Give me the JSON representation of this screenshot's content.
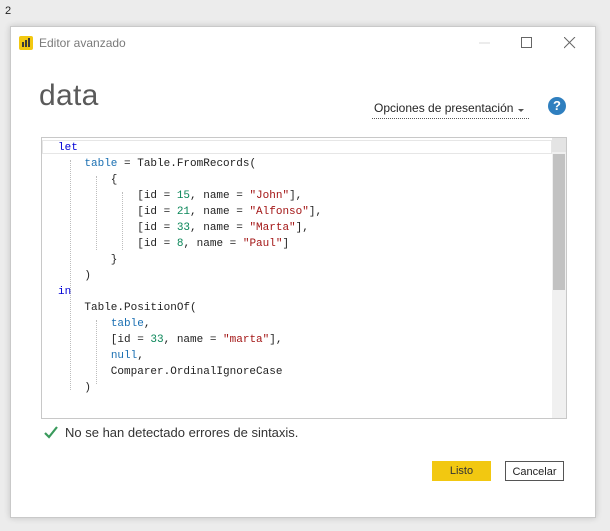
{
  "page_label": "2",
  "window": {
    "title": "Editor avanzado",
    "icon": "power-bi-icon"
  },
  "query": {
    "name": "data"
  },
  "toolbar": {
    "display_options_label": "Opciones de presentación",
    "help_symbol": "?"
  },
  "code_lines": [
    [
      {
        "t": "let",
        "c": "kw"
      }
    ],
    [
      {
        "t": "    "
      },
      {
        "t": "table",
        "c": "var"
      },
      {
        "t": " = Table.FromRecords("
      }
    ],
    [
      {
        "t": "        {"
      }
    ],
    [
      {
        "t": "            [id = "
      },
      {
        "t": "15",
        "c": "num"
      },
      {
        "t": ", name = "
      },
      {
        "t": "\"John\"",
        "c": "str"
      },
      {
        "t": "],"
      }
    ],
    [
      {
        "t": "            [id = "
      },
      {
        "t": "21",
        "c": "num"
      },
      {
        "t": ", name = "
      },
      {
        "t": "\"Alfonso\"",
        "c": "str"
      },
      {
        "t": "],"
      }
    ],
    [
      {
        "t": "            [id = "
      },
      {
        "t": "33",
        "c": "num"
      },
      {
        "t": ", name = "
      },
      {
        "t": "\"Marta\"",
        "c": "str"
      },
      {
        "t": "],"
      }
    ],
    [
      {
        "t": "            [id = "
      },
      {
        "t": "8",
        "c": "num"
      },
      {
        "t": ", name = "
      },
      {
        "t": "\"Paul\"",
        "c": "str"
      },
      {
        "t": "]"
      }
    ],
    [
      {
        "t": "        }"
      }
    ],
    [
      {
        "t": "    )"
      }
    ],
    [
      {
        "t": "in",
        "c": "kw"
      }
    ],
    [
      {
        "t": "    Table.PositionOf("
      }
    ],
    [
      {
        "t": "        "
      },
      {
        "t": "table",
        "c": "var"
      },
      {
        "t": ","
      }
    ],
    [
      {
        "t": "        [id = "
      },
      {
        "t": "33",
        "c": "num"
      },
      {
        "t": ", name = "
      },
      {
        "t": "\"marta\"",
        "c": "str"
      },
      {
        "t": "],"
      }
    ],
    [
      {
        "t": "        "
      },
      {
        "t": "null",
        "c": "var"
      },
      {
        "t": ","
      }
    ],
    [
      {
        "t": "        Comparer.OrdinalIgnoreCase"
      }
    ],
    [
      {
        "t": "    )"
      }
    ]
  ],
  "status": {
    "message": "No se han detectado errores de sintaxis.",
    "icon": "checkmark-icon",
    "color": "#3a9a5c"
  },
  "buttons": {
    "ok_label": "Listo",
    "cancel_label": "Cancelar"
  },
  "colors": {
    "accent": "#f2c811",
    "keyword": "#0000d6",
    "identifier": "#1a6fb2",
    "number": "#098658",
    "string": "#a31515"
  }
}
